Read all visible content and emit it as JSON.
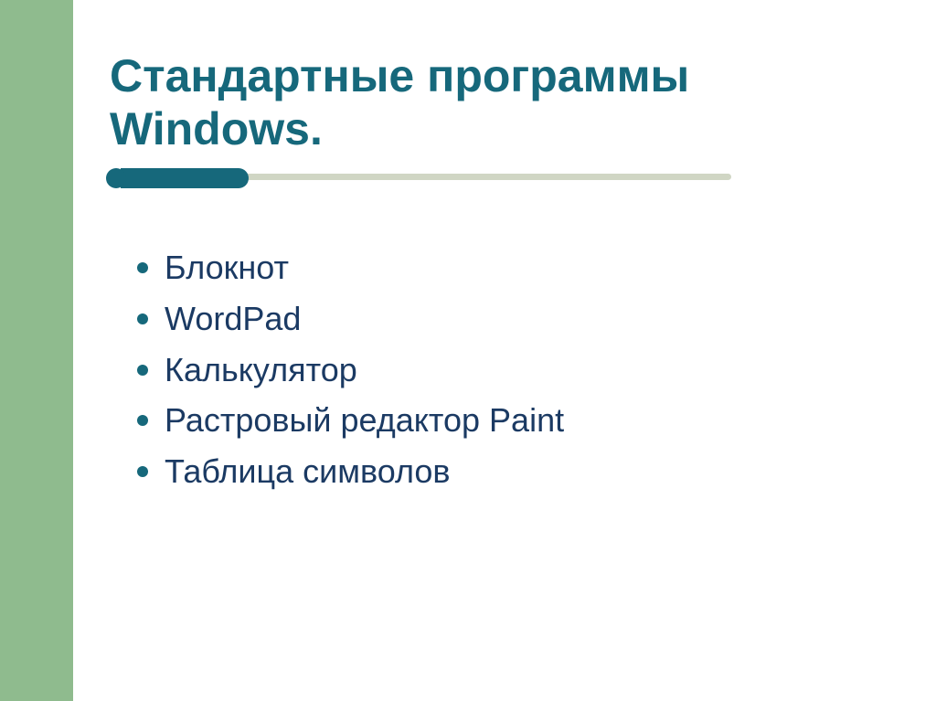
{
  "title_line1": "Стандартные программы",
  "title_line2": "Windows.",
  "items": [
    "Блокнот",
    "WordPad",
    "Калькулятор",
    "Растровый редактор Paint",
    "Таблица  символов"
  ]
}
